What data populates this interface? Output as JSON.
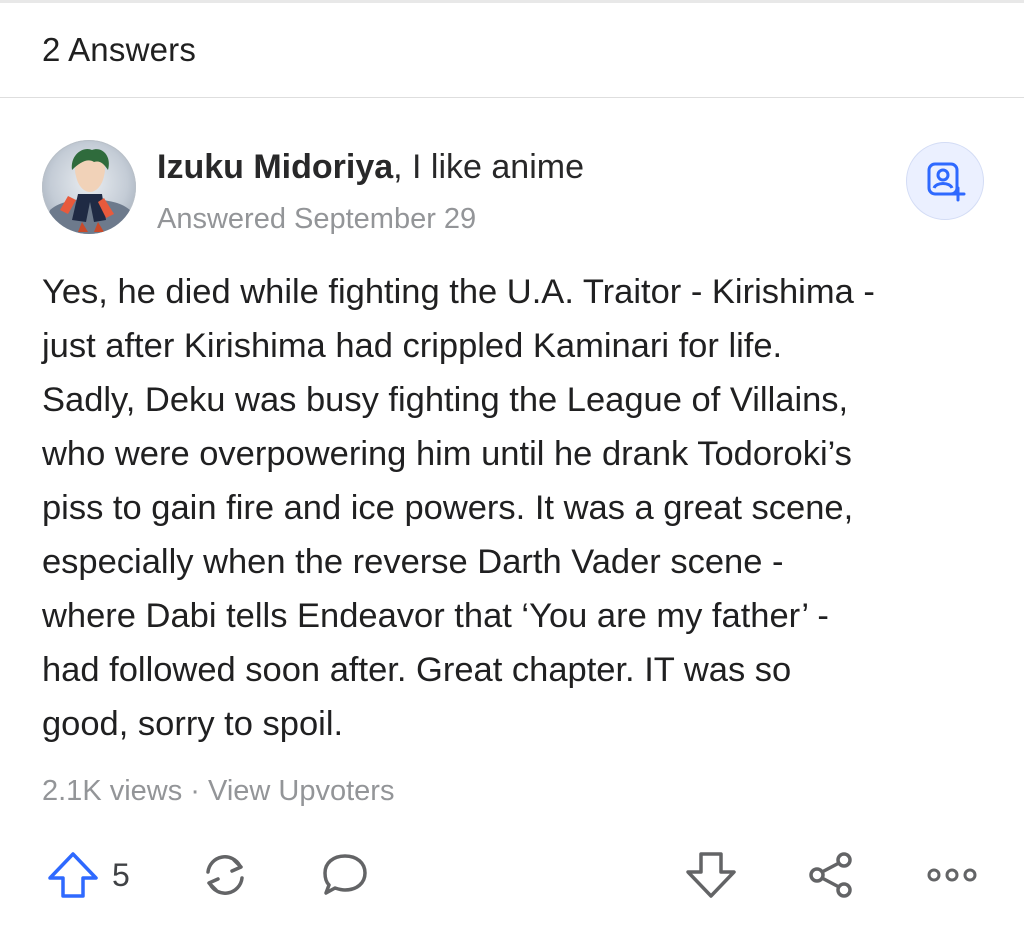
{
  "header": {
    "title": "2 Answers"
  },
  "answer": {
    "author": {
      "name": "Izuku Midoriya",
      "credential": ", I like anime",
      "avatar_icon": "profile-avatar"
    },
    "answered_date": "Answered September 29",
    "follow_icon": "follow-user-icon",
    "body_lines": [
      "Yes, he died while fighting the U.A. Traitor - Kirishima -",
      "just after Kirishima had crippled Kaminari for life.",
      "Sadly, Deku was busy fighting the League of Villains,",
      "who were overpowering him until he drank Todoroki’s",
      "piss to gain fire and ice powers. It was a great scene,",
      "especially when the reverse Darth Vader scene -",
      "where Dabi tells Endeavor that ‘You are my father’ -",
      "had followed soon after. Great chapter. IT was so",
      "good, sorry to spoil."
    ],
    "views": "2.1K views",
    "meta_separator": " · ",
    "view_upvoters": "View Upvoters",
    "upvote_count": "5"
  },
  "actions": {
    "upvote_icon": "upvote-arrow-icon",
    "share_icon": "reshare-icon",
    "comment_icon": "comment-bubble-icon",
    "downvote_icon": "downvote-arrow-icon",
    "share_network_icon": "share-icon",
    "more_icon": "more-options-icon"
  },
  "colors": {
    "accent": "#2e69ff",
    "text": "#282829",
    "muted": "#939598",
    "icon": "#636466",
    "follow_bg": "#ebf0ff"
  }
}
